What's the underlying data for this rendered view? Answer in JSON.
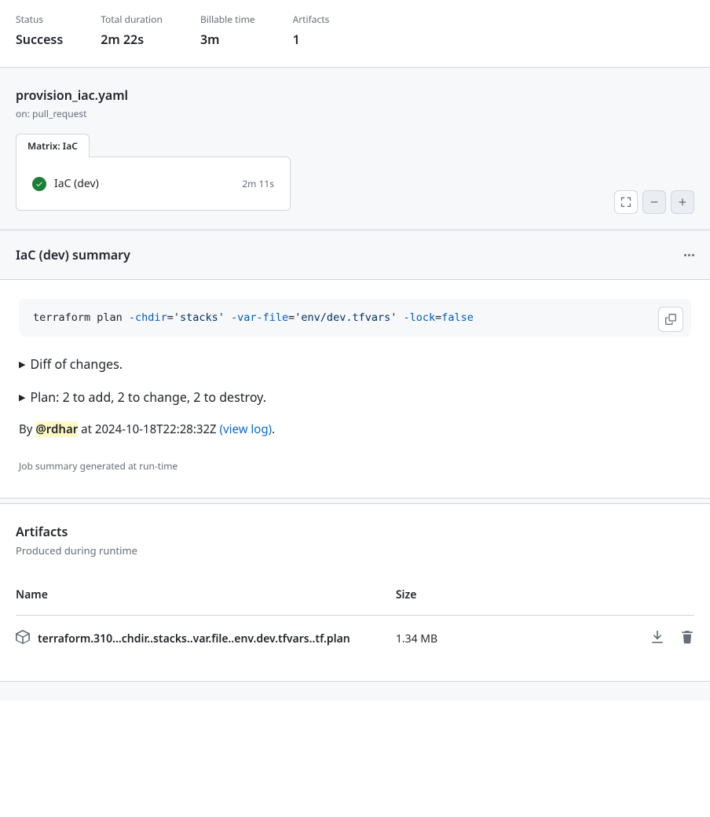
{
  "stats": {
    "status_label": "Status",
    "status_value": "Success",
    "duration_label": "Total duration",
    "duration_value": "2m 22s",
    "billable_label": "Billable time",
    "billable_value": "3m",
    "artifacts_label": "Artifacts",
    "artifacts_value": "1"
  },
  "workflow": {
    "file": "provision_iac.yaml",
    "trigger": "on: pull_request",
    "matrix_tab": "Matrix: IaC",
    "job_name": "IaC (dev)",
    "job_duration": "2m 11s"
  },
  "summary": {
    "title": "IaC (dev) summary",
    "code": {
      "cmd": "terraform plan",
      "flag1": " -chdir",
      "eq1": "=",
      "str1": "'stacks'",
      "flag2": " -var-file",
      "eq2": "=",
      "str2": "'env/dev.tfvars'",
      "flag3": " -lock",
      "eq3": "=",
      "bool": "false"
    },
    "diff_label": "Diff of changes.",
    "plan_label": "Plan: 2 to add, 2 to change, 2 to destroy.",
    "byline_prefix": "By ",
    "byline_mention": "@rdhar",
    "byline_mid": " at ",
    "byline_time": "2024-10-18T22:28:32Z",
    "byline_link": "(view log)",
    "byline_suffix": ".",
    "footnote": "Job summary generated at run-time"
  },
  "artifacts": {
    "title": "Artifacts",
    "subtitle": "Produced during runtime",
    "col_name": "Name",
    "col_size": "Size",
    "items": [
      {
        "name": "terraform.310...chdir..stacks..var.file..env.dev.tfvars..tf.plan",
        "size": "1.34 MB"
      }
    ]
  }
}
